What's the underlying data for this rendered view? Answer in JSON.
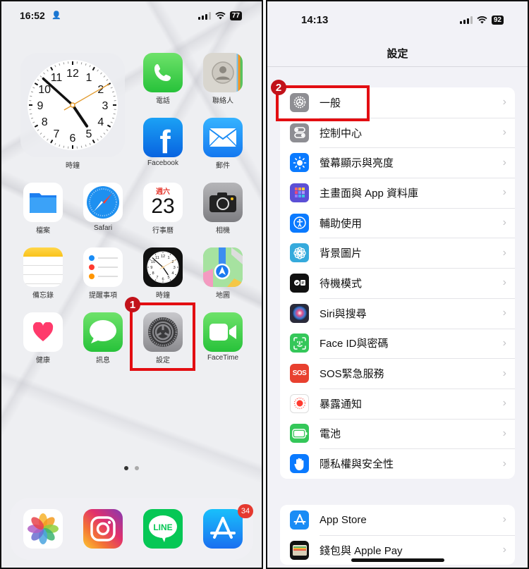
{
  "home": {
    "status": {
      "time": "16:52",
      "battery": "77"
    },
    "clock_widget": {
      "label": "時鐘",
      "hour": 4,
      "minute": 52,
      "second": 10,
      "numerals": [
        "12",
        "1",
        "2",
        "3",
        "4",
        "5",
        "6",
        "7",
        "8",
        "9",
        "10",
        "11"
      ]
    },
    "apps": [
      {
        "id": "phone",
        "label": "電話"
      },
      {
        "id": "contacts",
        "label": "聯絡人"
      },
      {
        "id": "facebook",
        "label": "Facebook"
      },
      {
        "id": "mail",
        "label": "郵件"
      },
      {
        "id": "files",
        "label": "檔案"
      },
      {
        "id": "safari",
        "label": "Safari"
      },
      {
        "id": "calendar",
        "label": "行事曆",
        "weekday": "週六",
        "day": "23"
      },
      {
        "id": "camera",
        "label": "相機"
      },
      {
        "id": "notes",
        "label": "備忘錄"
      },
      {
        "id": "reminders",
        "label": "提醒事項"
      },
      {
        "id": "clock",
        "label": "時鐘"
      },
      {
        "id": "maps",
        "label": "地圖"
      },
      {
        "id": "health",
        "label": "健康"
      },
      {
        "id": "messages",
        "label": "訊息"
      },
      {
        "id": "settings",
        "label": "設定"
      },
      {
        "id": "facetime",
        "label": "FaceTime"
      }
    ],
    "dock": [
      {
        "id": "photos"
      },
      {
        "id": "instagram"
      },
      {
        "id": "line",
        "text": "LINE"
      },
      {
        "id": "appstore",
        "badge": "34"
      }
    ],
    "page_dots": {
      "count": 2,
      "active": 0
    },
    "step_marker": "1"
  },
  "settings": {
    "status": {
      "time": "14:13",
      "battery": "92"
    },
    "title": "設定",
    "step_marker": "2",
    "groups": [
      {
        "items": [
          {
            "label": "一般",
            "icon": "gear-icon",
            "color": "#8e8e93"
          },
          {
            "label": "控制中心",
            "icon": "toggles-icon",
            "color": "#8e8e93"
          },
          {
            "label": "螢幕顯示與亮度",
            "icon": "sun-icon",
            "color": "#0a7aff"
          },
          {
            "label": "主畫面與 App 資料庫",
            "icon": "grid-icon",
            "color": "#5b4fd6"
          },
          {
            "label": "輔助使用",
            "icon": "accessibility-icon",
            "color": "#0a7aff"
          },
          {
            "label": "背景圖片",
            "icon": "flower-icon",
            "color": "#35aadc"
          },
          {
            "label": "待機模式",
            "icon": "standby-icon",
            "color": "#111111"
          },
          {
            "label": "Siri與搜尋",
            "icon": "siri-icon",
            "color": "#2b2b3a"
          },
          {
            "label": "Face ID與密碼",
            "icon": "faceid-icon",
            "color": "#34c759"
          },
          {
            "label": "SOS緊急服務",
            "icon": "sos-icon",
            "color": "#e8402f"
          },
          {
            "label": "暴露通知",
            "icon": "exposure-icon",
            "color": "#ffffff"
          },
          {
            "label": "電池",
            "icon": "battery-icon",
            "color": "#34c759"
          },
          {
            "label": "隱私權與安全性",
            "icon": "hand-icon",
            "color": "#0a7aff"
          }
        ]
      },
      {
        "items": [
          {
            "label": "App Store",
            "icon": "appstore-icon",
            "color": "#1a8cf5"
          },
          {
            "label": "錢包與 Apple Pay",
            "icon": "wallet-icon",
            "color": "#111111"
          }
        ]
      }
    ],
    "chevron": "›",
    "sos_text": "SOS"
  }
}
